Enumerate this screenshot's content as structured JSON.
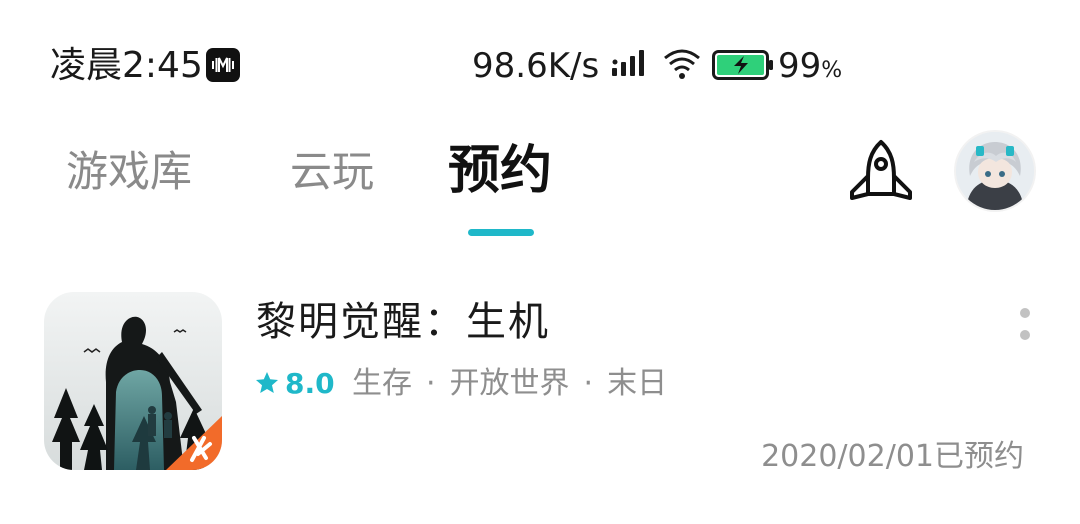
{
  "status_bar": {
    "time": "凌晨2:45",
    "music_icon": "music-app-icon",
    "net_speed": "98.6K/s",
    "signal_icon": "cellular-signal-icon",
    "wifi_icon": "wifi-icon",
    "battery_icon": "battery-charging-icon",
    "battery_percent": "99",
    "battery_unit": "%"
  },
  "nav": {
    "tabs": [
      {
        "label": "游戏库"
      },
      {
        "label": "云玩"
      },
      {
        "label": "预约"
      }
    ],
    "active_tab": "预约",
    "accent_color": "#1fb8c9",
    "rocket_icon": "rocket-icon",
    "avatar_icon": "user-avatar"
  },
  "reservations": [
    {
      "title": "黎明觉醒：生机",
      "rating": "8.0",
      "star_icon": "star-icon",
      "tags": [
        "生存",
        "开放世界",
        "末日"
      ],
      "reserve_info": "2020/02/01已预约",
      "more_icon": "more-vertical-icon"
    }
  ]
}
